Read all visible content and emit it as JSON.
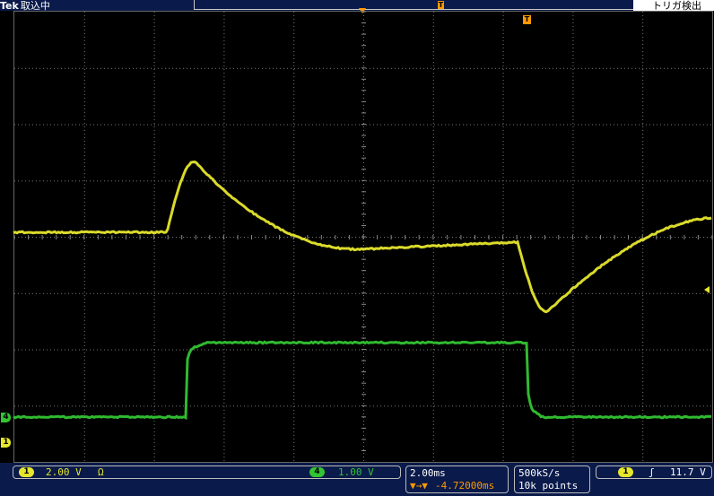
{
  "header": {
    "brand": "Tek",
    "acq_status": "取込中",
    "trigger_status": "トリガ検出",
    "trigger_marker": "T"
  },
  "channels": {
    "ch1": {
      "number": "1",
      "scale": "2.00 V",
      "coupling": "Ω",
      "color": "#e6e62d"
    },
    "ch4": {
      "number": "4",
      "scale": "1.00 V",
      "color": "#33c433"
    }
  },
  "horizontal": {
    "scale": "2.00ms",
    "position_label": "▼→▼",
    "position_value": "-4.72000ms"
  },
  "acquisition": {
    "sample_rate": "500kS/s",
    "record_length": "10k points"
  },
  "trigger": {
    "source": "1",
    "slope_icon": "rising-edge",
    "slope_glyph": "ʃ",
    "level": "11.7 V"
  },
  "colors": {
    "background": "#000000",
    "bar": "#0a1a4a",
    "trigger_accent": "#ff9a00"
  }
}
